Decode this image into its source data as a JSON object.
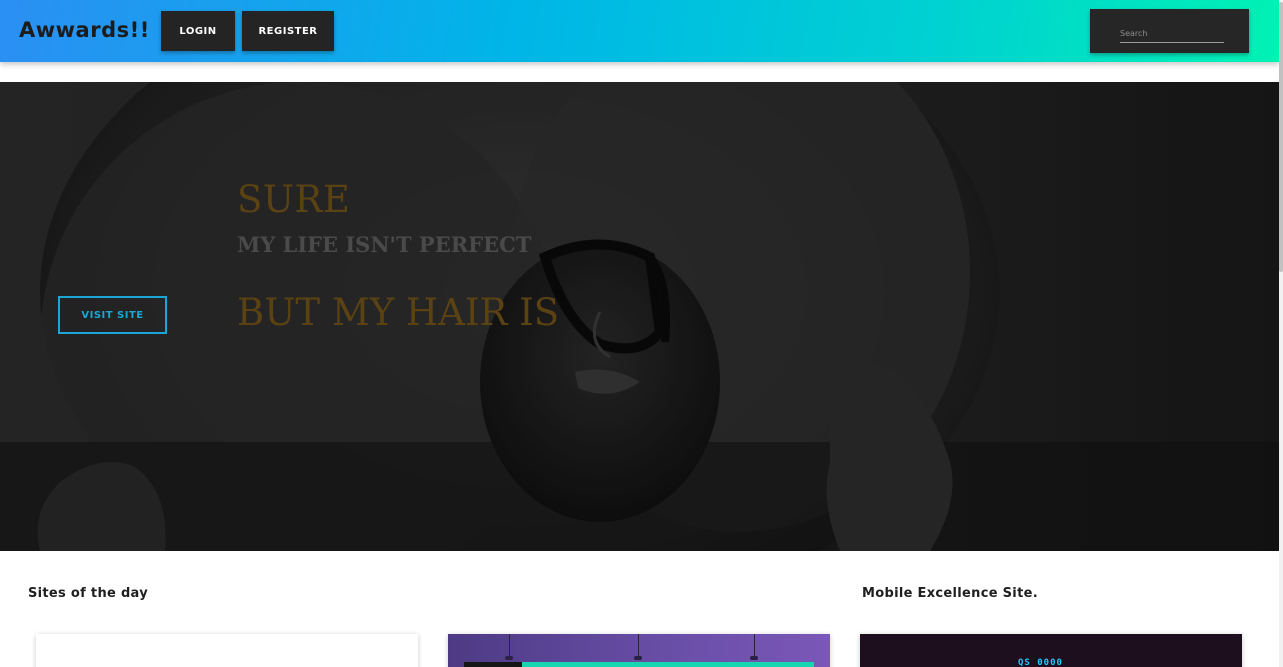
{
  "navbar": {
    "brand": "Awwards!!",
    "login_label": "LOGIN",
    "register_label": "REGISTER",
    "search_placeholder": "Search"
  },
  "hero": {
    "line1": "SURE",
    "line2": "MY LIFE ISN'T PERFECT",
    "line3": "BUT MY HAIR IS",
    "visit_label": "VISIT SITE"
  },
  "sections": {
    "sites_title": "Sites of the day",
    "mobile_title": "Mobile Excellence Site."
  },
  "cards": {
    "mobile_logo_text": "QS 0000"
  },
  "colors": {
    "gradient_start": "#2b8ff3",
    "gradient_end": "#00f2b4",
    "button_dark": "#242424",
    "accent_blue": "#1aa6d6",
    "hero_text_gold": "#5a4213"
  }
}
